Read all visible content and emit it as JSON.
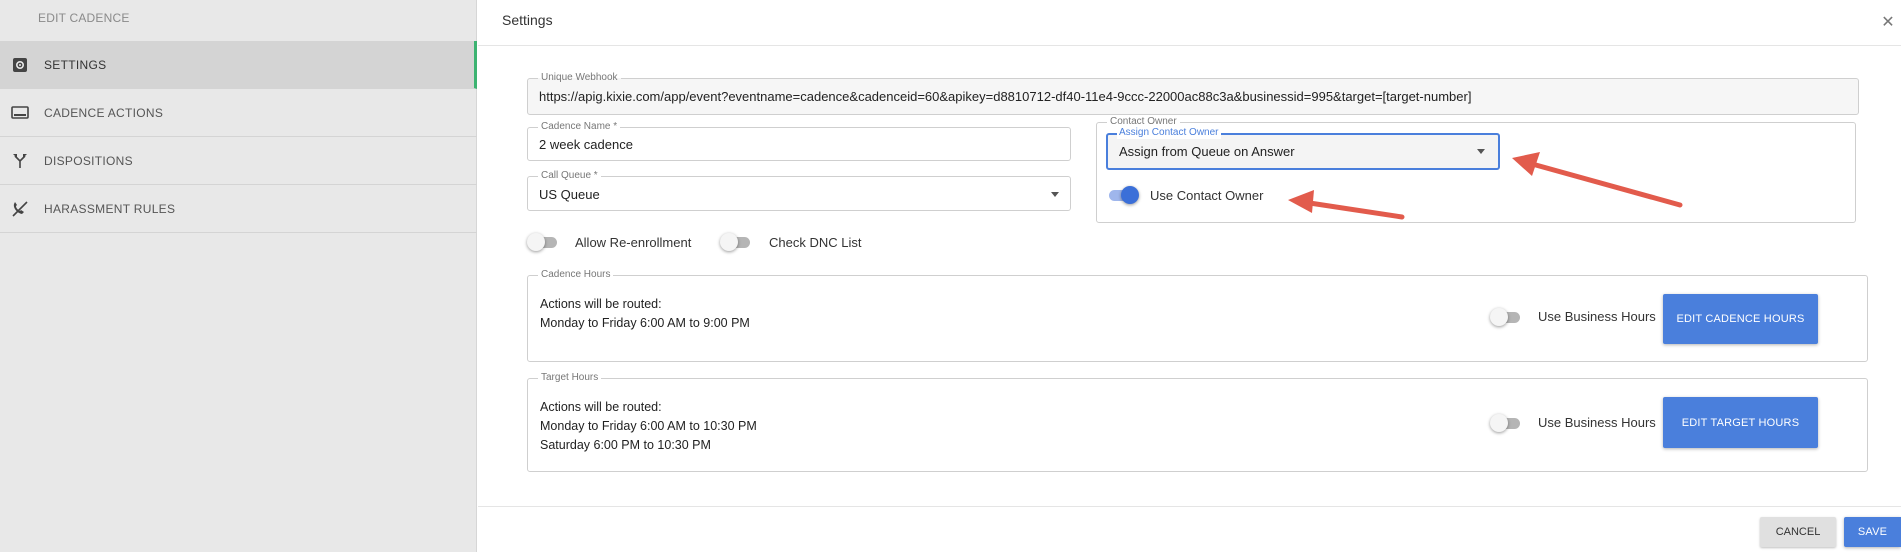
{
  "sidebar": {
    "title": "EDIT CADENCE",
    "items": [
      {
        "label": "SETTINGS",
        "icon": "gear-icon",
        "active": true
      },
      {
        "label": "CADENCE ACTIONS",
        "icon": "monitor-icon",
        "active": false
      },
      {
        "label": "DISPOSITIONS",
        "icon": "split-arrows-icon",
        "active": false
      },
      {
        "label": "HARASSMENT RULES",
        "icon": "no-calls-icon",
        "active": false
      }
    ]
  },
  "header": {
    "title": "Settings"
  },
  "webhook": {
    "legend": "Unique Webhook",
    "value": "https://apig.kixie.com/app/event?eventname=cadence&cadenceid=60&apikey=d8810712-df40-11e4-9ccc-22000ac88c3a&businessid=995&target=[target-number]"
  },
  "cadence_name": {
    "legend": "Cadence Name *",
    "value": "2 week cadence"
  },
  "call_queue": {
    "legend": "Call Queue *",
    "value": "US Queue"
  },
  "contact_owner": {
    "legend": "Contact Owner",
    "assign_legend": "Assign Contact Owner",
    "assign_value": "Assign from Queue on Answer",
    "use_owner_label": "Use Contact Owner",
    "use_owner_on": true
  },
  "options": {
    "allow_reenrollment_label": "Allow Re-enrollment",
    "allow_reenrollment_on": false,
    "check_dnc_label": "Check DNC List",
    "check_dnc_on": false
  },
  "cadence_hours": {
    "legend": "Cadence Hours",
    "line1": "Actions will be routed:",
    "line2": "Monday to Friday 6:00 AM to 9:00 PM",
    "use_business_label": "Use Business Hours",
    "use_business_on": false,
    "button": "EDIT CADENCE HOURS"
  },
  "target_hours": {
    "legend": "Target Hours",
    "line1": "Actions will be routed:",
    "line2": "Monday to Friday 6:00 AM to 10:30 PM",
    "line3": "Saturday 6:00 PM to 10:30 PM",
    "use_business_label": "Use Business Hours",
    "use_business_on": false,
    "button": "EDIT TARGET HOURS"
  },
  "footer": {
    "cancel": "CANCEL",
    "save": "SAVE"
  },
  "colors": {
    "accent": "#4a7fdc",
    "active_marker": "#3cb371",
    "annotation": "#e25b4c"
  }
}
